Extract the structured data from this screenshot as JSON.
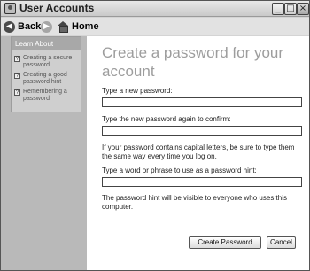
{
  "window": {
    "title": "User Accounts"
  },
  "titlebar_buttons": {
    "minimize": "_",
    "maximize": "□",
    "close": "×"
  },
  "nav": {
    "back_label": "Back",
    "home_label": "Home",
    "back_glyph": "◀",
    "forward_glyph": "▶"
  },
  "sidebar": {
    "header": "Learn About",
    "items": [
      {
        "label": "Creating a secure password",
        "icon": "help-topic-icon"
      },
      {
        "label": "Creating a good password hint",
        "icon": "help-topic-icon"
      },
      {
        "label": "Remembering a password",
        "icon": "help-topic-icon"
      }
    ]
  },
  "main": {
    "title": "Create a password for your account",
    "new_password_label": "Type a new password:",
    "new_password_value": "",
    "confirm_label": "Type the new password again to confirm:",
    "confirm_value": "",
    "capitals_note": "If your password contains capital letters, be sure to type them the same way every time you log on.",
    "hint_label": "Type a word or phrase to use as a password hint:",
    "hint_value": "",
    "hint_note": "The password hint will be visible to everyone who uses this computer."
  },
  "buttons": {
    "create": "Create Password",
    "cancel": "Cancel"
  }
}
